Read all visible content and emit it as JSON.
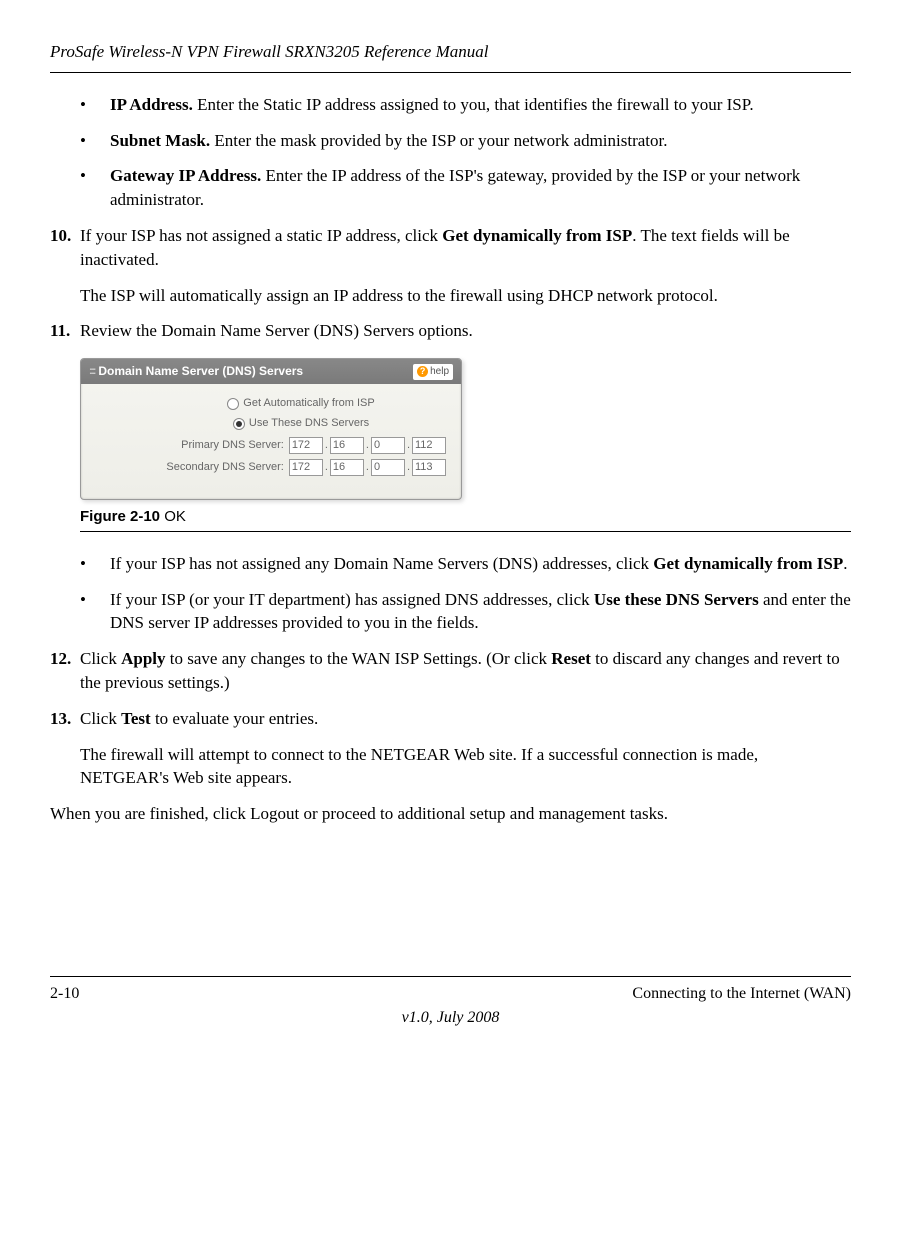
{
  "header": "ProSafe Wireless-N VPN Firewall SRXN3205 Reference Manual",
  "items": {
    "ip": {
      "label": "IP Address.",
      "text": " Enter the Static IP address assigned to you, that identifies the firewall to your ISP."
    },
    "subnet": {
      "label": "Subnet Mask.",
      "text": " Enter the mask provided by the ISP or your network administrator."
    },
    "gateway": {
      "label": "Gateway IP Address.",
      "text": " Enter the IP address of the ISP's gateway, provided by the ISP or your network administrator."
    },
    "step10": {
      "num": "10.",
      "text1": "If your ISP has not assigned a static IP address, click ",
      "bold1": "Get dynamically from ISP",
      "text2": ". The text fields will be inactivated.",
      "para2": "The ISP will automatically assign an IP address to the firewall using DHCP network protocol."
    },
    "step11": {
      "num": "11.",
      "text": "Review the Domain Name Server (DNS) Servers options."
    },
    "dnsBullet1": {
      "text1": "If your ISP has not assigned any Domain Name Servers (DNS) addresses, click ",
      "bold1": "Get dynamically from ISP",
      "text2": "."
    },
    "dnsBullet2": {
      "text1": "If your ISP (or your IT department) has assigned DNS addresses, click ",
      "bold1": "Use these DNS Servers",
      "text2": " and enter the DNS server IP addresses provided to you in the fields."
    },
    "step12": {
      "num": "12.",
      "text1": "Click ",
      "bold1": "Apply",
      "text2": " to save any changes to the WAN ISP Settings. (Or click ",
      "bold2": "Reset",
      "text3": " to discard any changes and revert to the previous settings.)"
    },
    "step13": {
      "num": "13.",
      "text1": "Click ",
      "bold1": "Test",
      "text2": " to evaluate your entries.",
      "para2": "The firewall will attempt to connect to the NETGEAR Web site. If a successful connection is made, NETGEAR's Web site appears."
    },
    "final": "When you are finished, click Logout or proceed to additional setup and management tasks."
  },
  "figure": {
    "title": "Domain Name Server (DNS) Servers",
    "help": "help",
    "opt1": "Get Automatically from ISP",
    "opt2": "Use These DNS Servers",
    "primary": "Primary DNS Server:",
    "secondary": "Secondary DNS Server:",
    "p": [
      "172",
      "16",
      "0",
      "112"
    ],
    "s": [
      "172",
      "16",
      "0",
      "113"
    ],
    "captionBold": "Figure 2-10",
    "captionRest": " OK"
  },
  "footer": {
    "page": "2-10",
    "section": "Connecting to the Internet (WAN)",
    "version": "v1.0, July 2008"
  }
}
